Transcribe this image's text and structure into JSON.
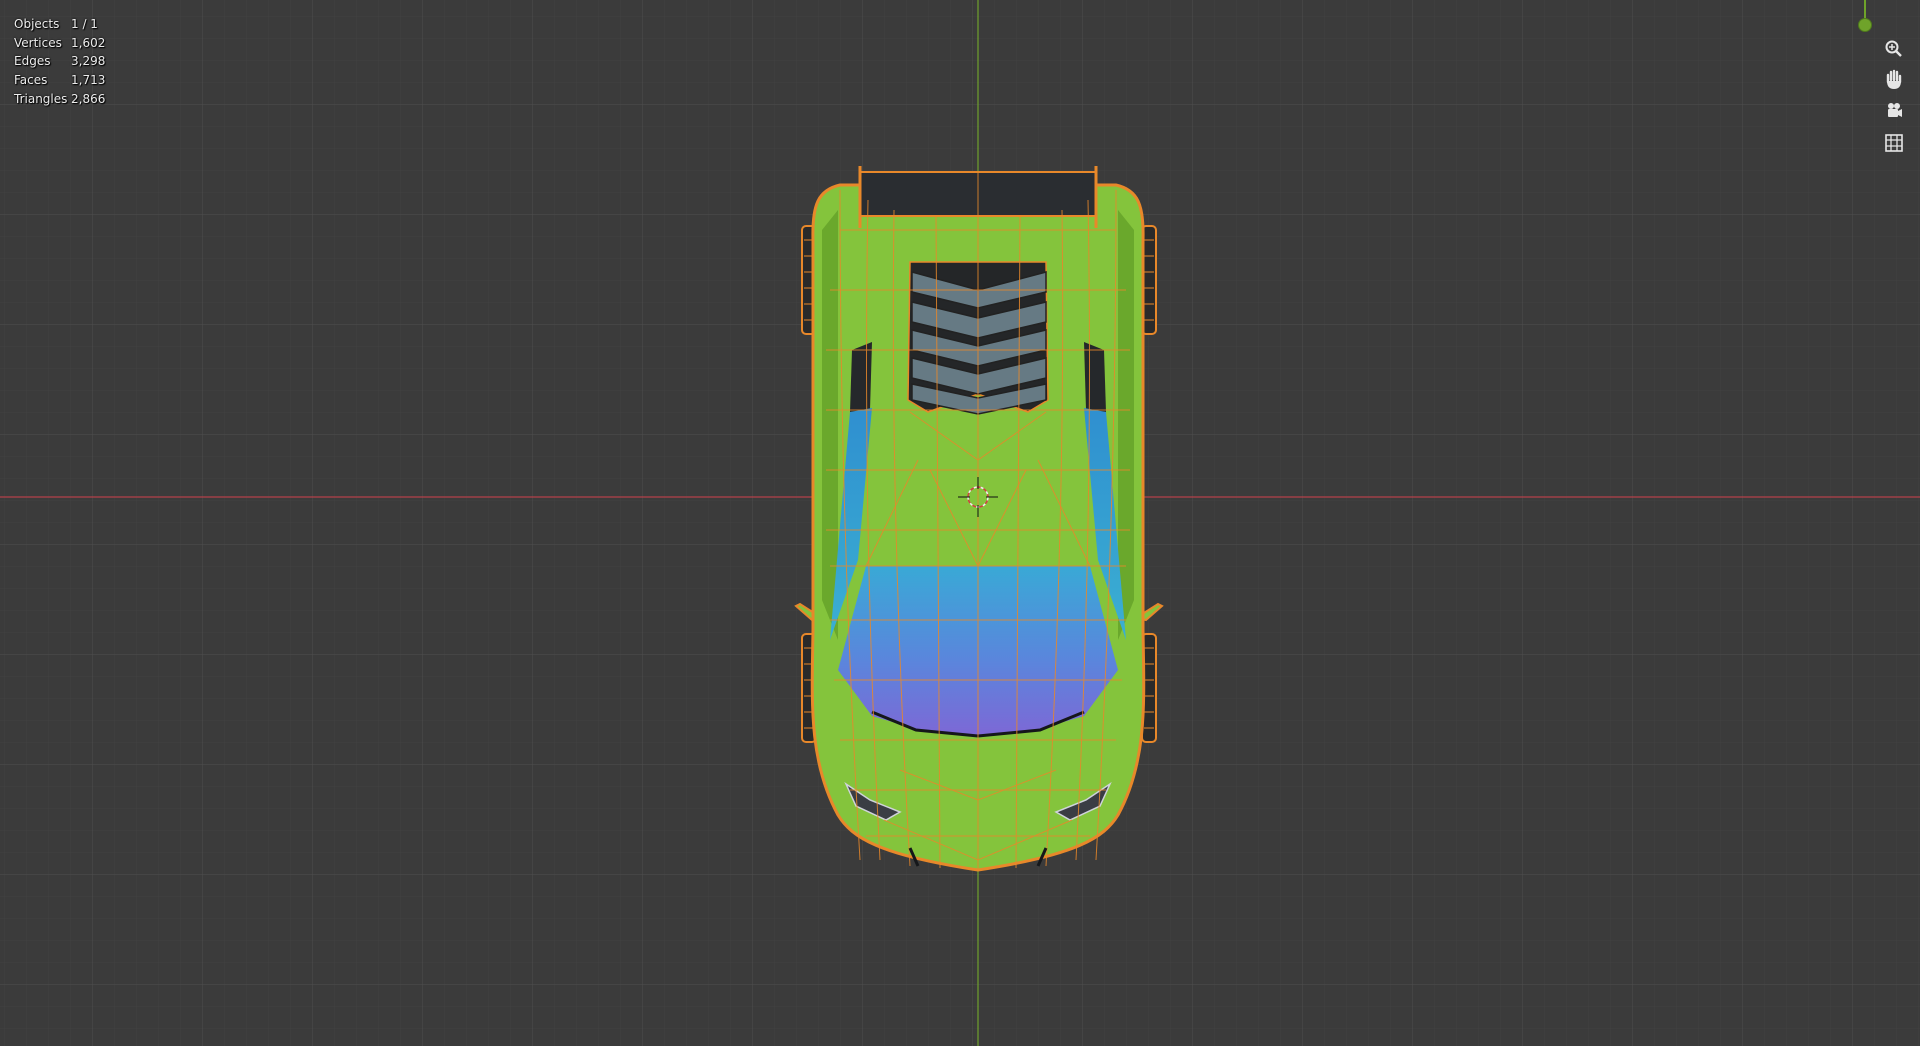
{
  "stats": {
    "rows": [
      {
        "label": "Objects",
        "value": "1 / 1"
      },
      {
        "label": "Vertices",
        "value": "1,602"
      },
      {
        "label": "Edges",
        "value": "3,298"
      },
      {
        "label": "Faces",
        "value": "1,713"
      },
      {
        "label": "Triangles",
        "value": "2,866"
      }
    ]
  },
  "navigation": {
    "buttons": [
      {
        "name": "zoom-icon"
      },
      {
        "name": "pan-hand-icon"
      },
      {
        "name": "camera-view-icon"
      },
      {
        "name": "orthographic-grid-icon"
      }
    ]
  },
  "colors": {
    "background": "#3b3b3b",
    "grid_minor": "#424242",
    "grid_major": "#4a4a4a",
    "x_axis": "#b3404a",
    "y_axis": "#6c9a2e",
    "car_body": "#84c43c",
    "windshield_top": "#3aa6d8",
    "windshield_bottom": "#7a6ad8",
    "wire": "#e8882a",
    "vents": "#667a84",
    "gizmo_dot": "#6fa32a"
  }
}
